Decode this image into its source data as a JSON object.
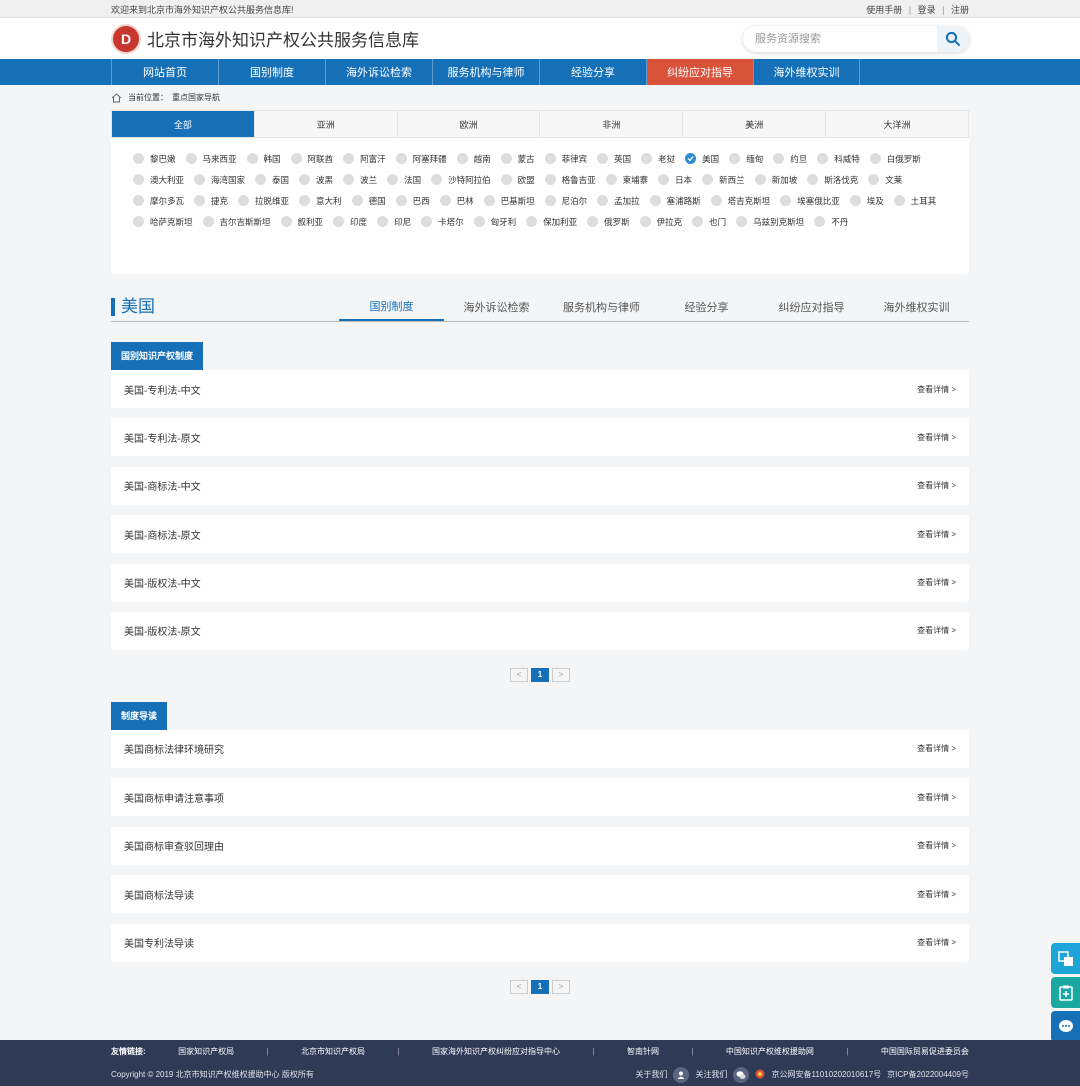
{
  "topbar": {
    "welcome": "欢迎来到北京市海外知识产权公共服务信息库!",
    "manual": "使用手册",
    "login": "登录",
    "register": "注册",
    "sep": "|"
  },
  "header": {
    "title": "北京市海外知识产权公共服务信息库",
    "search_placeholder": "服务资源搜索"
  },
  "nav": {
    "items": [
      "网站首页",
      "国别制度",
      "海外诉讼检索",
      "服务机构与律师",
      "经验分享",
      "纠纷应对指导",
      "海外维权实训"
    ]
  },
  "breadcrumb": {
    "label": "当前位置：",
    "current": "重点国家导航"
  },
  "continents": [
    "全部",
    "亚洲",
    "欧洲",
    "非洲",
    "美洲",
    "大洋洲"
  ],
  "countries": [
    "黎巴嫩",
    "马来西亚",
    "韩国",
    "阿联酋",
    "阿富汗",
    "阿塞拜疆",
    "越南",
    "蒙古",
    "菲律宾",
    "英国",
    "老挝",
    "美国",
    "缅甸",
    "约旦",
    "科威特",
    "白俄罗斯",
    "澳大利亚",
    "海湾国家",
    "泰国",
    "波黑",
    "波兰",
    "法国",
    "沙特阿拉伯",
    "欧盟",
    "格鲁吉亚",
    "柬埔寨",
    "日本",
    "新西兰",
    "新加坡",
    "斯洛伐克",
    "文莱",
    "摩尔多瓦",
    "捷克",
    "拉脱维亚",
    "意大利",
    "德国",
    "巴西",
    "巴林",
    "巴基斯坦",
    "尼泊尔",
    "孟加拉",
    "塞浦路斯",
    "塔吉克斯坦",
    "埃塞俄比亚",
    "埃及",
    "土耳其",
    "哈萨克斯坦",
    "吉尔吉斯斯坦",
    "叙利亚",
    "印度",
    "印尼",
    "卡塔尔",
    "匈牙利",
    "保加利亚",
    "俄罗斯",
    "伊拉克",
    "也门",
    "乌兹别克斯坦",
    "不丹"
  ],
  "selected_country": "美国",
  "section": {
    "title": "美国",
    "tabs": [
      "国别制度",
      "海外诉讼检索",
      "服务机构与律师",
      "经验分享",
      "纠纷应对指导",
      "海外维权实训"
    ]
  },
  "block1": {
    "label": "国别知识产权制度",
    "rows": [
      "美国-专利法-中文",
      "美国-专利法-原文",
      "美国-商标法-中文",
      "美国-商标法-原文",
      "美国-版权法-中文",
      "美国-版权法-原文"
    ]
  },
  "block2": {
    "label": "制度导读",
    "rows": [
      "美国商标法律环境研究",
      "美国商标申请注意事项",
      "美国商标审查驳回理由",
      "美国商标法导读",
      "美国专利法导读"
    ]
  },
  "more_label": "查看详情 >",
  "pager": {
    "prev": "<",
    "current": "1",
    "next": ">"
  },
  "footer": {
    "links_label": "友情链接:",
    "links": [
      "国家知识产权局",
      "北京市知识产权局",
      "国家海外知识产权纠纷应对指导中心",
      "智南针网",
      "中国知识产权维权援助网",
      "中国国际贸易促进委员会"
    ],
    "copyright": "Copyright © 2019 北京市知识产权维权援助中心 版权所有",
    "about": "关于我们",
    "follow": "关注我们",
    "police": "京公网安备11010202010617号",
    "icp": "京ICP备2022004409号"
  },
  "logo_text": "D",
  "colors": {
    "primary": "#1670b8",
    "accent": "#d9533b",
    "footer": "#2f3a56"
  }
}
